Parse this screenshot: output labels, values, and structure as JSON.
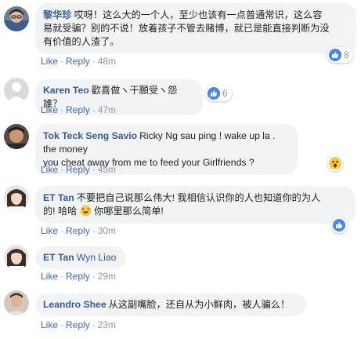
{
  "actions": {
    "like": "Like",
    "reply": "Reply",
    "sep": "·"
  },
  "comments": [
    {
      "author": "黎华珍",
      "lines": [
        "哎呀！这么大的一个人，至少也该有一点普通常识，这么容",
        "易就受骗？别的不说！放着孩子不管去赌博，就已是能直接判断为没",
        "有价值的人渣了。"
      ],
      "time": "48m",
      "reaction": {
        "icon": "like-icon",
        "count": "8"
      }
    },
    {
      "author": "Karen Teo",
      "lines": [
        "歡喜做ヽ干願受ヽ怨誰？"
      ],
      "time": "47m",
      "reaction": {
        "icon": "like-icon",
        "count": "6"
      }
    },
    {
      "author": "Tok Teck Seng Savio",
      "lines": [
        "Ricky Ng sau ping ! wake up la . the money",
        "you cheat away from me to feed your Girlfriends ?"
      ],
      "time": "45m",
      "reaction": {
        "icon": "wow-icon",
        "count": ""
      }
    },
    {
      "author": "ET Tan",
      "lines": [
        "不要把自己说那么伟大! 我相信认识你的人也知道你的为人",
        "的! 哈哈"
      ],
      "line2_tail": "你哪里那么简单!",
      "time": "30m",
      "reaction": {
        "icon": "like-icon",
        "count": ""
      }
    },
    {
      "author": "ET Tan",
      "mention": "Wyn Liao",
      "time": "29m"
    },
    {
      "author": "Leandro Shee",
      "lines": [
        "从这副嘴脸，还自从为小鲜肉，被人骗么！"
      ],
      "time": "23m"
    }
  ],
  "colors": {
    "author": "#385898",
    "link": "#4267b2",
    "bubble": "#f2f3f5",
    "meta": "#90949c"
  }
}
